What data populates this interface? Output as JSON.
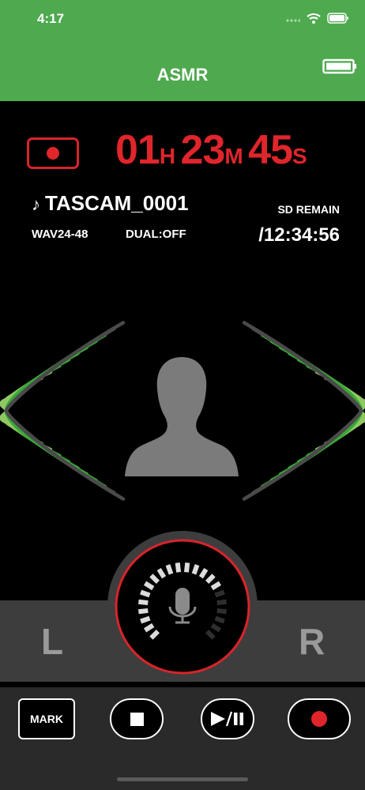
{
  "status_bar": {
    "time": "4:17",
    "icons": [
      "signal-icon",
      "wifi-icon",
      "battery-icon"
    ]
  },
  "header": {
    "title": "ASMR",
    "icon": "device-battery-icon"
  },
  "recorder": {
    "timer": {
      "hours": "01",
      "hours_unit": "H",
      "minutes": "23",
      "minutes_unit": "M",
      "seconds": "45",
      "seconds_unit": "S"
    },
    "file_name": "TASCAM_0001",
    "file_icon": "music-note-icon",
    "format": "WAV24-48",
    "dual": "DUAL:OFF",
    "sd_label": "SD REMAIN",
    "sd_value": "/12:34:56"
  },
  "level_meters": {
    "left_active_fraction": 0.82,
    "right_active_fraction": 0.82
  },
  "input_knob": {
    "icon": "microphone-icon",
    "level_fraction": 0.72
  },
  "channels": {
    "left": "L",
    "right": "R"
  },
  "toolbar": {
    "mark_label": "MARK",
    "stop_icon": "stop-icon",
    "play_pause_icon": "play-pause-icon",
    "record_icon": "record-icon"
  },
  "colors": {
    "header_green": "#4ea94f",
    "record_red": "#e0252b",
    "meter_light": "#8fc862",
    "meter_green": "#3aa836",
    "meter_off": "#4a4a4a"
  }
}
